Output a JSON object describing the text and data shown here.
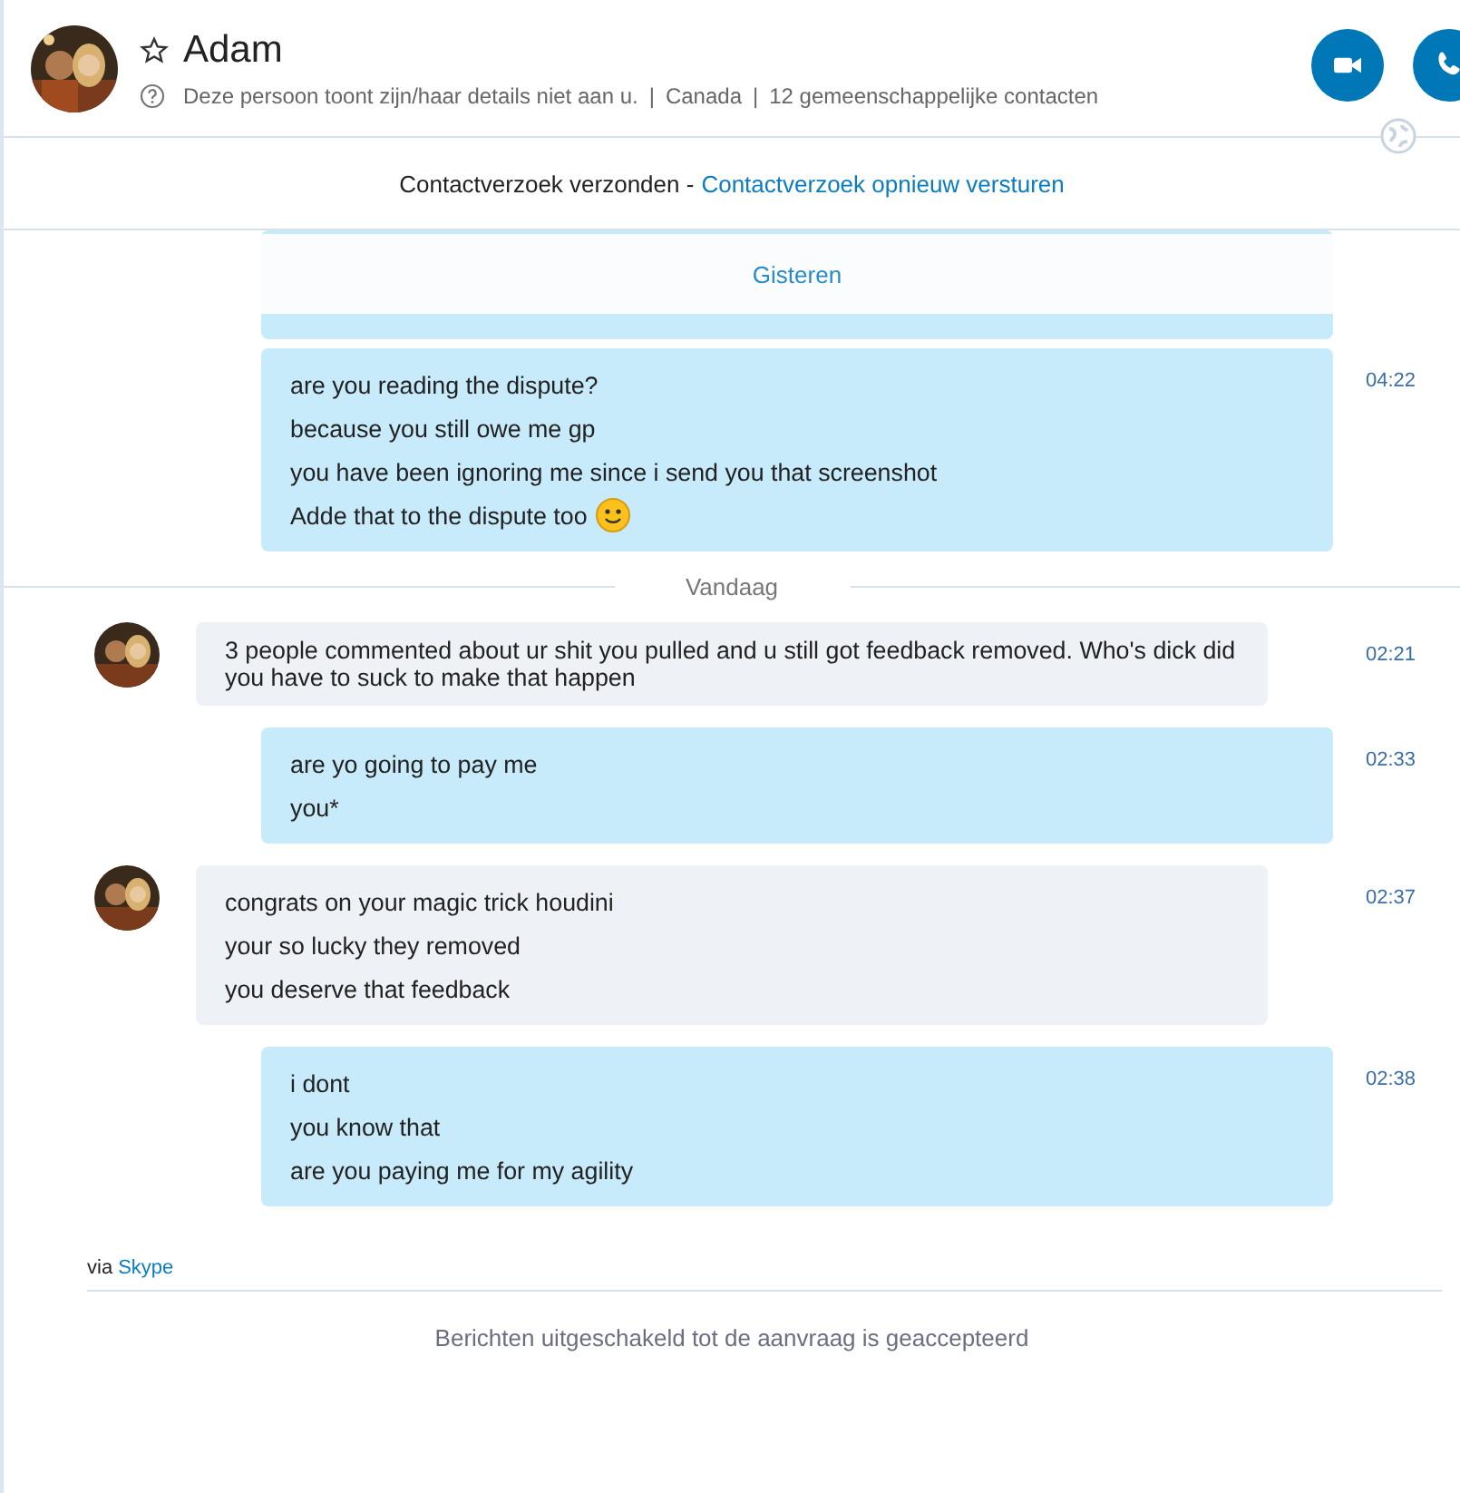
{
  "header": {
    "name": "Adam",
    "favorite": false,
    "separator": "|",
    "details": [
      "Deze persoon toont zijn/haar details niet aan u.",
      "Canada",
      "12 gemeenschappelijke contacten"
    ]
  },
  "request": {
    "text": "Contactverzoek verzonden -",
    "link": "Contactverzoek opnieuw versturen"
  },
  "sticky_date": "Gisteren",
  "timeline": [
    {
      "kind": "sent",
      "time": "04:22",
      "lines": [
        "are you reading the dispute?",
        "because you still owe me gp",
        "you have been ignoring me since i send you that screenshot",
        "Adde that to the dispute too"
      ],
      "emoji": true
    },
    {
      "kind": "divider",
      "label": "Vandaag"
    },
    {
      "kind": "received",
      "time": "02:21",
      "lines": [
        "3 people commented about ur shit you pulled and u still got feedback removed. Who's dick did you have to suck to make that happen"
      ],
      "emoji": false
    },
    {
      "kind": "sent",
      "time": "02:33",
      "lines": [
        "are yo going to pay me",
        "you*"
      ],
      "emoji": false
    },
    {
      "kind": "received",
      "time": "02:37",
      "lines": [
        "congrats on your magic trick houdini",
        "your so lucky they removed",
        "you deserve that feedback"
      ],
      "emoji": false
    },
    {
      "kind": "sent",
      "time": "02:38",
      "lines": [
        "i dont",
        "you know that",
        "are you paying me for my agility"
      ],
      "emoji": false
    }
  ],
  "via": {
    "text": "via",
    "link": "Skype"
  },
  "footer": "Berichten uitgeschakeld tot de aanvraag is geaccepteerd"
}
